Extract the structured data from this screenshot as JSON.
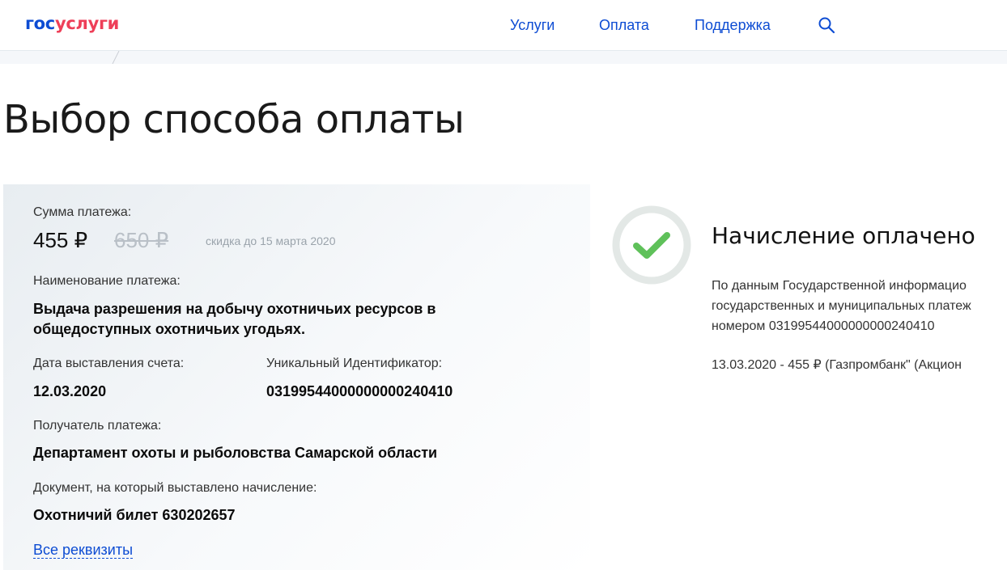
{
  "header": {
    "logo_part1": "гос",
    "logo_part2": "услуги",
    "nav": [
      "Услуги",
      "Оплата",
      "Поддержка"
    ],
    "search_icon": "search-icon"
  },
  "page": {
    "title": "Выбор способа оплаты"
  },
  "payment": {
    "amount_label": "Сумма платежа:",
    "amount": "455 ₽",
    "old_amount": "650 ₽",
    "discount_note": "скидка до 15 марта 2020",
    "name_label": "Наименование платежа:",
    "name_line1": "Выдача разрешения на добычу охотничьих ресурсов в",
    "name_line2": "общедоступных охотничьих угодьях.",
    "date_label": "Дата выставления счета:",
    "date_value": "12.03.2020",
    "uid_label": "Уникальный Идентификатор:",
    "uid_value": "03199544000000000240410",
    "recipient_label": "Получатель платежа:",
    "recipient_value": "Департамент охоты и рыболовства Самарской области",
    "document_label": "Документ, на который выставлено начисление:",
    "document_value": "Охотничий билет 630202657",
    "details_link": "Все реквизиты"
  },
  "status": {
    "icon": "checkmark-icon",
    "title": "Начисление оплачено",
    "text_line1": "По данным Государственной информацио",
    "text_line2": "государственных и муниципальных платеж",
    "text_line3": "номером 03199544000000000240410",
    "payment_line": "13.03.2020 - 455 ₽  (Газпромбанк\" (Акцион"
  },
  "colors": {
    "brand_blue": "#0d4cd3",
    "brand_red": "#ee3f58",
    "success_green": "#5fc15a",
    "circle_gray": "#e3e8e6"
  }
}
